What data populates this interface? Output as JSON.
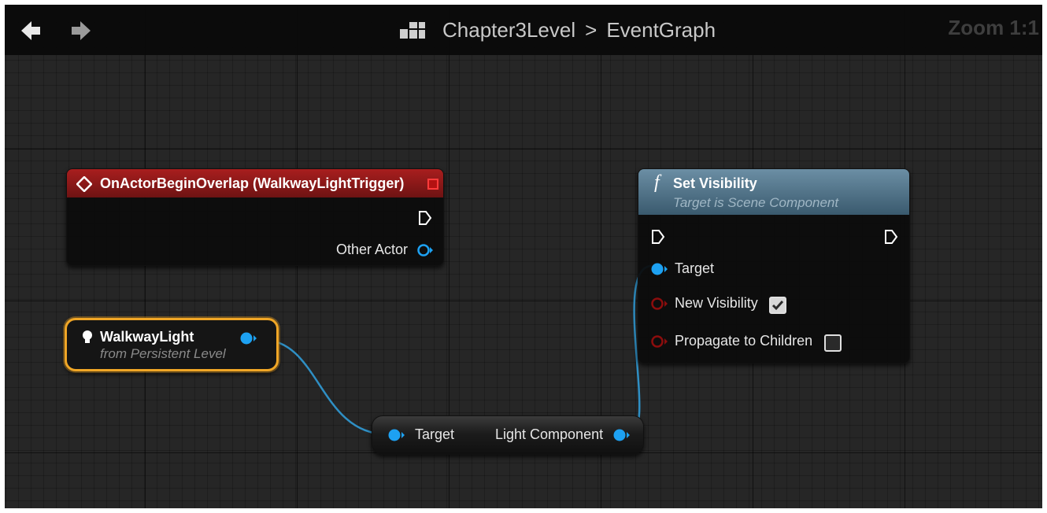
{
  "toolbar": {
    "back_icon": "arrow-left-icon",
    "forward_icon": "arrow-right-icon",
    "blueprint_icon": "blueprint-graph-icon",
    "breadcrumb_level": "Chapter3Level",
    "breadcrumb_separator": ">",
    "breadcrumb_graph": "EventGraph",
    "zoom": "Zoom 1:1"
  },
  "nodes": {
    "event": {
      "title": "OnActorBeginOverlap (WalkwayLightTrigger)",
      "pin_other_actor": "Other Actor",
      "header_color": "#a81e1e"
    },
    "variable": {
      "name": "WalkwayLight",
      "source": "from Persistent Level",
      "border_color": "#f0a626"
    },
    "get_component": {
      "pin_target": "Target",
      "pin_output": "Light Component"
    },
    "function": {
      "icon": "f",
      "title": "Set Visibility",
      "subtitle": "Target is Scene Component",
      "pin_target": "Target",
      "pin_new_visibility": "New Visibility",
      "new_visibility_checked": true,
      "pin_propagate": "Propagate to Children",
      "propagate_checked": false,
      "header_color": "#4f7388"
    }
  },
  "colors": {
    "object_pin": "#1da1f2",
    "bool_pin": "#8b0d0d",
    "wire": "#2f8fc4"
  }
}
